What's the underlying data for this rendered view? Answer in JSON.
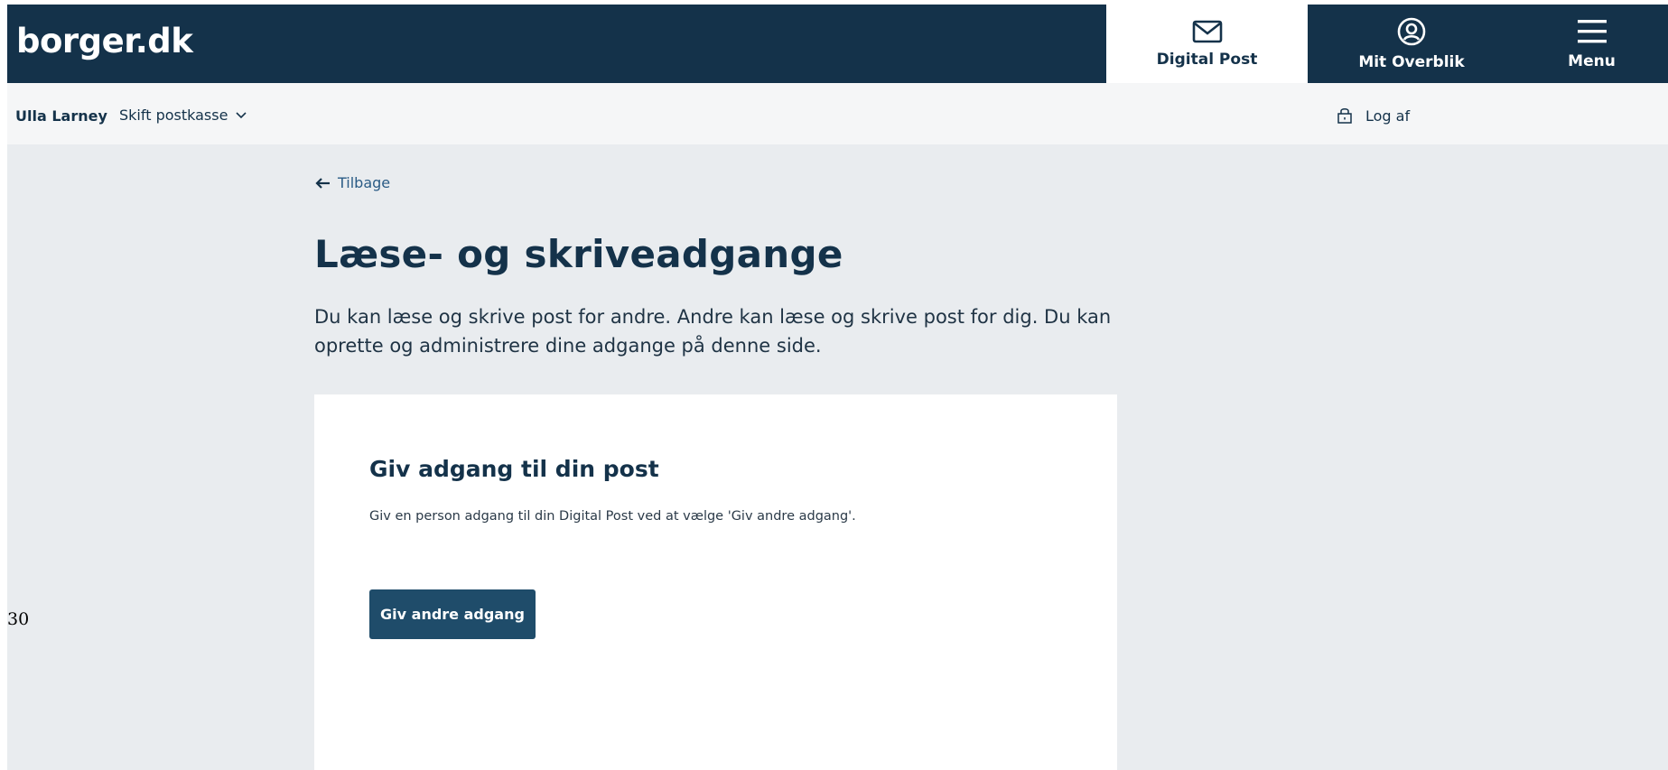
{
  "header": {
    "logo": "borger.dk",
    "nav": {
      "digital_post": "Digital Post",
      "mit_overblik": "Mit Overblik",
      "menu": "Menu"
    }
  },
  "subheader": {
    "user_name": "Ulla Larney",
    "switch_mailbox": "Skift postkasse",
    "log_off": "Log af"
  },
  "main": {
    "back_label": "Tilbage",
    "title": "Læse- og skriveadgange",
    "intro_line1": "Du kan læse og skrive post for andre. Andre kan læse og skrive post for dig. Du kan",
    "intro_line2": "oprette og administrere dine adgange på denne side.",
    "card": {
      "title": "Giv adgang til din post",
      "text": "Giv en person adgang til din Digital Post ved at vælge 'Giv andre adgang'.",
      "button": "Giv andre adgang"
    }
  },
  "page_number": "30",
  "colors": {
    "header_bg": "#14324a",
    "page_bg": "#e9ecef",
    "button_bg": "#1f4c6a",
    "link": "#2a5b85"
  },
  "icons": {
    "digital_post": "envelope-icon",
    "mit_overblik": "user-circle-icon",
    "menu": "hamburger-icon",
    "switch": "chevron-down-icon",
    "log_off": "lock-icon",
    "back": "arrow-left-icon"
  }
}
